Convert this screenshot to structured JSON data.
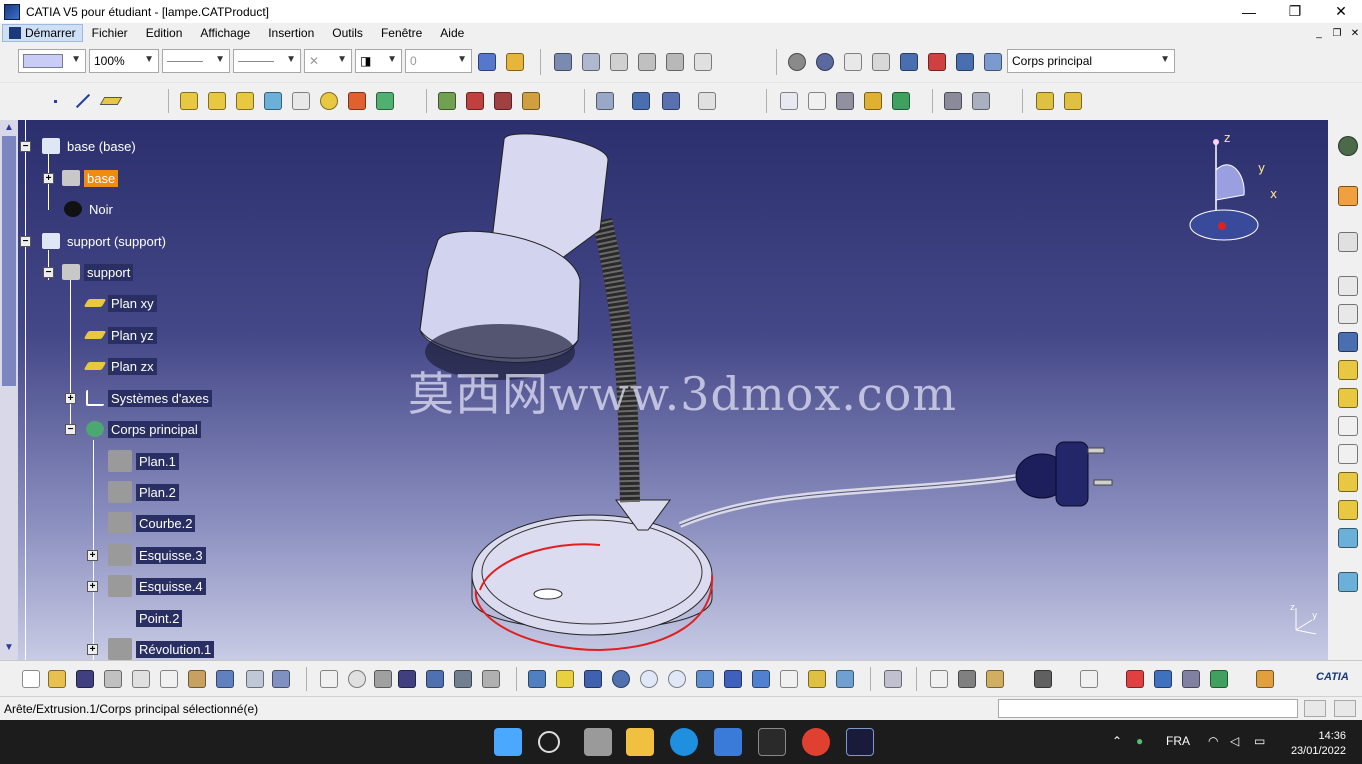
{
  "window": {
    "title": "CATIA V5 pour étudiant - [lampe.CATProduct]",
    "minimize": "—",
    "maximize": "❐",
    "close": "✕"
  },
  "menu": {
    "start": "Démarrer",
    "items": [
      "Fichier",
      "Edition",
      "Affichage",
      "Insertion",
      "Outils",
      "Fenêtre",
      "Aide"
    ]
  },
  "toolbar": {
    "zoom_value": "100%",
    "line_weight_value": "0",
    "layer_value": "0",
    "body_select": "Corps principal"
  },
  "tree": [
    {
      "label": "base (base)",
      "style": "plain"
    },
    {
      "label": "base",
      "style": "selected"
    },
    {
      "label": "Noir",
      "style": "plain"
    },
    {
      "label": "support  (support)",
      "style": "plain"
    },
    {
      "label": "support",
      "style": "highlight"
    },
    {
      "label": "Plan xy",
      "style": "highlight"
    },
    {
      "label": "Plan yz",
      "style": "highlight"
    },
    {
      "label": "Plan zx",
      "style": "highlight"
    },
    {
      "label": "Systèmes d'axes",
      "style": "highlight"
    },
    {
      "label": "Corps principal",
      "style": "highlight"
    },
    {
      "label": "Plan.1",
      "style": "highlight"
    },
    {
      "label": "Plan.2",
      "style": "highlight"
    },
    {
      "label": "Courbe.2",
      "style": "highlight"
    },
    {
      "label": "Esquisse.3",
      "style": "highlight"
    },
    {
      "label": "Esquisse.4",
      "style": "highlight"
    },
    {
      "label": "Point.2",
      "style": "highlight"
    },
    {
      "label": "Révolution.1",
      "style": "highlight"
    }
  ],
  "viewport": {
    "watermark": "莫西网www.3dmox.com",
    "compass": {
      "x": "x",
      "y": "y",
      "z": "z"
    },
    "mini_axis": {
      "y": "y",
      "z": "z"
    }
  },
  "logo": "CATIA",
  "status": {
    "message": "Arête/Extrusion.1/Corps principal sélectionné(e)"
  },
  "taskbar": {
    "language": "FRA",
    "time": "14:36",
    "date": "23/01/2022"
  }
}
